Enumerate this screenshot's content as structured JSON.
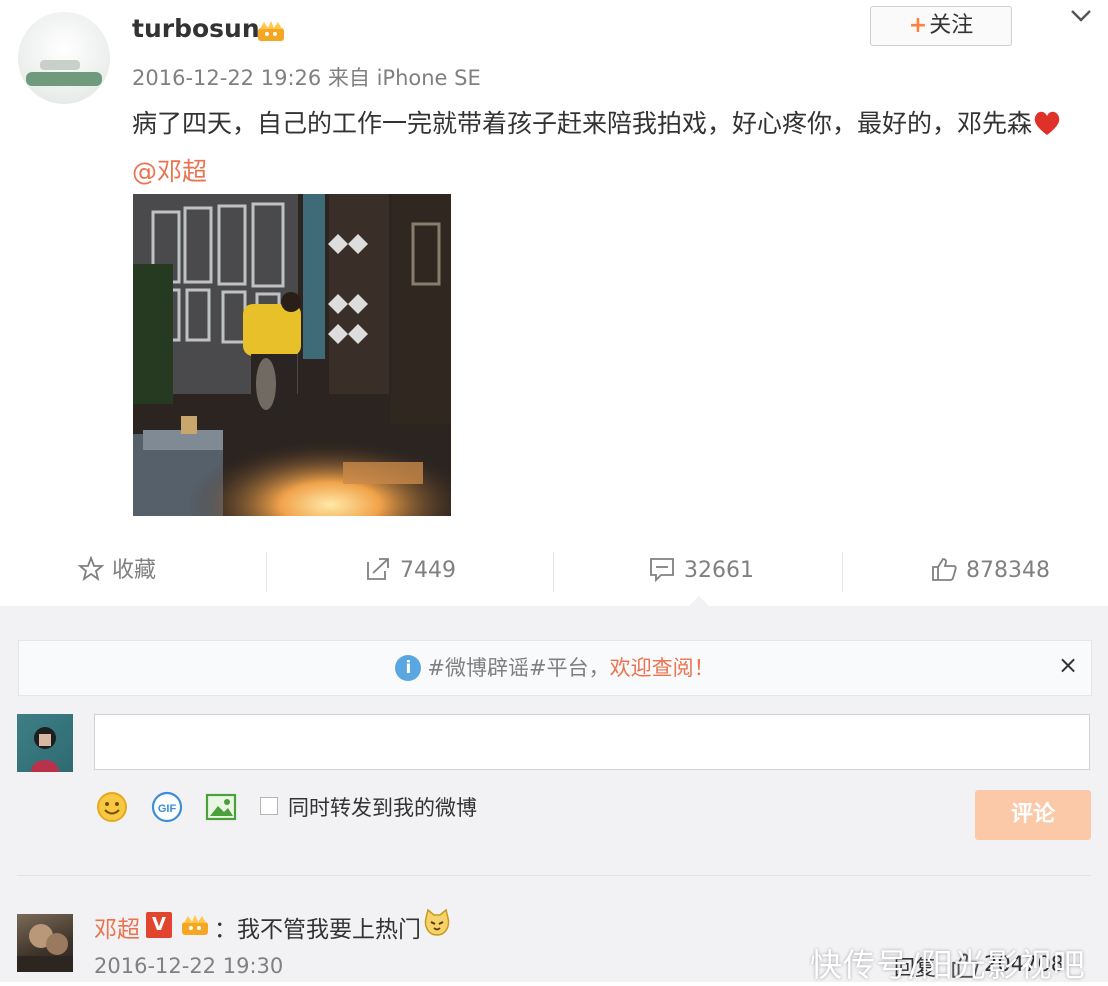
{
  "post": {
    "username": "turbosun",
    "follow_label": "关注",
    "meta": "2016-12-22 19:26 来自 iPhone SE",
    "text_main": "病了四天，自己的工作一完就带着孩子赶来陪我拍戏，好心疼你，最好的，邓先森",
    "mention": "@邓超"
  },
  "actions": {
    "favorite_label": "收藏",
    "repost_count": "7449",
    "comment_count": "32661",
    "like_count": "878348"
  },
  "notice": {
    "prefix": "#微博辟谣#平台，",
    "highlight": "欢迎查阅",
    "suffix": "！"
  },
  "composer": {
    "repost_checkbox_label": "同时转发到我的微博",
    "submit_label": "评论"
  },
  "comment": {
    "author": "邓超",
    "verified_badge": "V",
    "text": "：我不管我要上热门",
    "time": "2016-12-22 19:30",
    "reply_label": "回复",
    "likes": "204708"
  },
  "watermark": "快传号/阳光影视吧",
  "colors": {
    "accent": "#eb7350",
    "follow_plus": "#ff8140",
    "submit_disabled": "#fbc8a8",
    "comment_bg": "#f2f2f5"
  }
}
